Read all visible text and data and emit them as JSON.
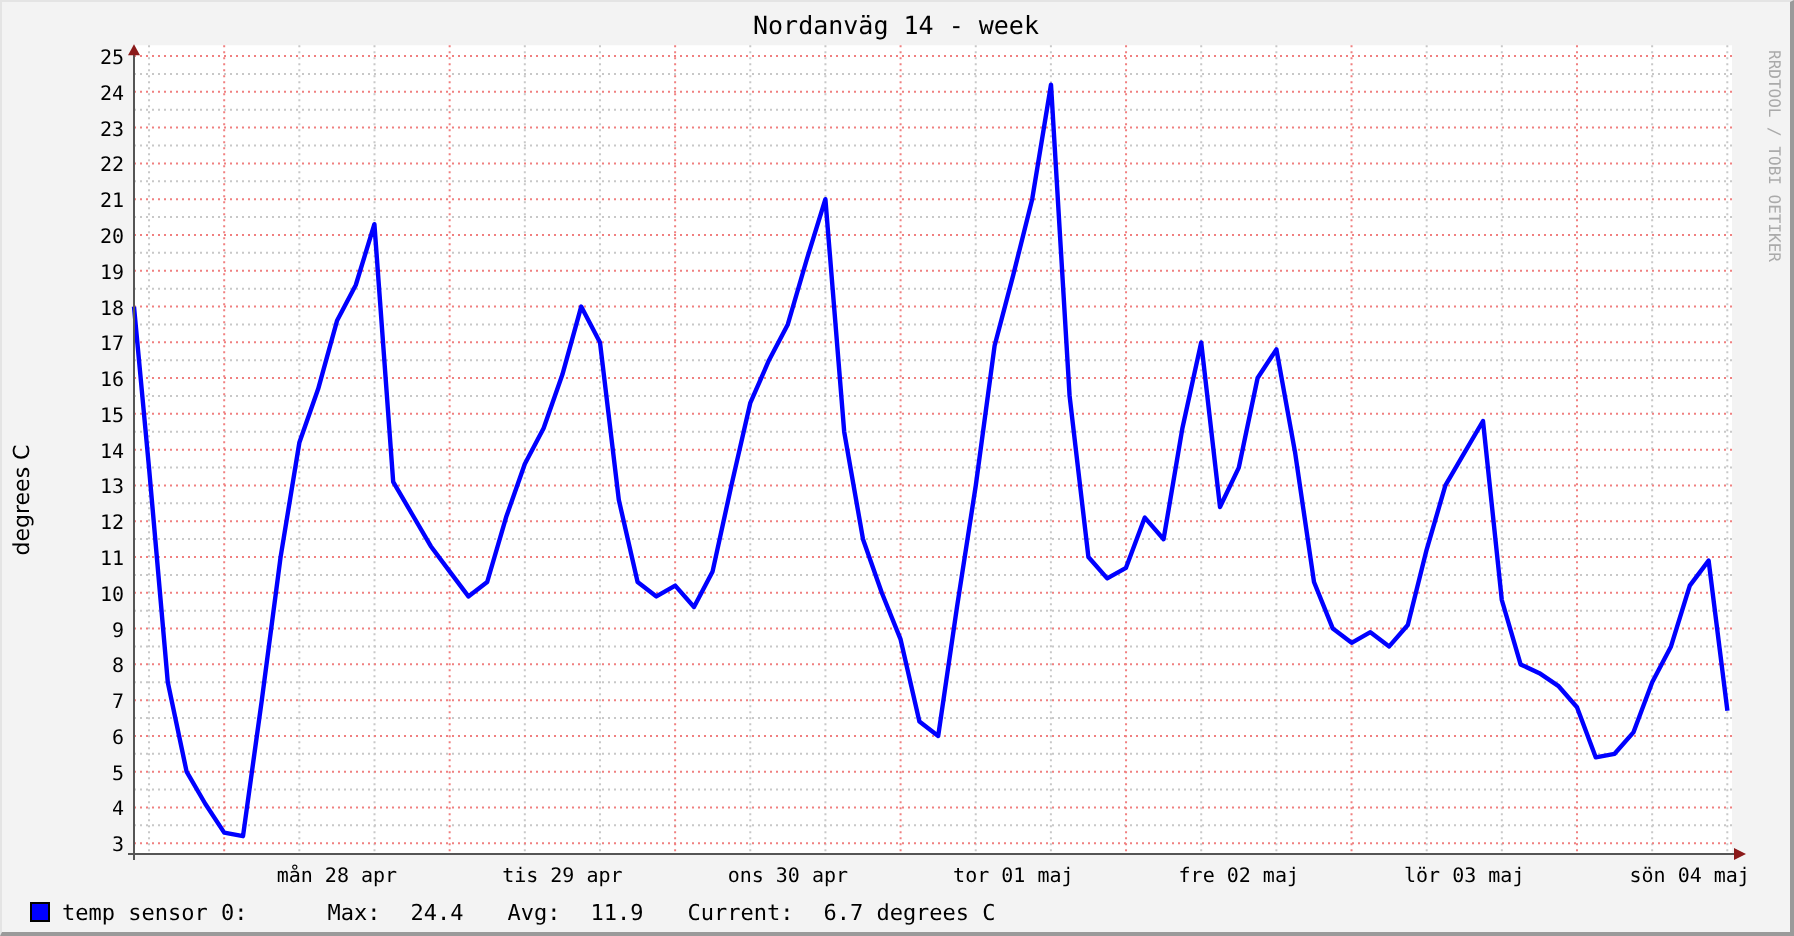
{
  "title": "Nordanväg 14 - week",
  "side_text": "RRDTOOL / TOBI OETIKER",
  "chart": {
    "chart_data": {
      "type": "line",
      "ylabel": "degrees C",
      "grid": true,
      "categories": [
        null,
        null,
        null,
        null,
        null,
        null,
        null,
        null,
        null,
        null,
        null,
        "mån 28 apr",
        null,
        null,
        null,
        null,
        null,
        null,
        null,
        null,
        null,
        null,
        null,
        "tis 29 apr",
        null,
        null,
        null,
        null,
        null,
        null,
        null,
        null,
        null,
        null,
        null,
        "ons 30 apr",
        null,
        null,
        null,
        null,
        null,
        null,
        null,
        null,
        null,
        null,
        null,
        "tor 01 maj",
        null,
        null,
        null,
        null,
        null,
        null,
        null,
        null,
        null,
        null,
        null,
        "fre 02 maj",
        null,
        null,
        null,
        null,
        null,
        null,
        null,
        null,
        null,
        null,
        null,
        "lör 03 maj",
        null,
        null,
        null,
        null,
        null,
        null,
        null,
        null,
        null,
        null,
        null,
        "sön 04 maj",
        null,
        null
      ],
      "series": [
        {
          "name": "temp sensor 0:",
          "color": "#0000ff",
          "values": [
            18,
            13.5,
            7.5,
            5.0,
            4.1,
            3.3,
            3.2,
            7.0,
            11.0,
            14.2,
            15.7,
            17.6,
            18.6,
            20.3,
            13.1,
            12.2,
            11.3,
            10.6,
            9.9,
            10.3,
            12.1,
            13.6,
            14.6,
            16.1,
            18.0,
            17.0,
            12.6,
            10.3,
            9.9,
            10.2,
            9.6,
            10.6,
            13.0,
            15.3,
            16.5,
            17.5,
            19.3,
            21.0,
            14.5,
            11.5,
            10.0,
            8.7,
            6.4,
            6.0,
            9.6,
            13.0,
            16.9,
            18.9,
            21.0,
            24.2,
            15.5,
            11.0,
            10.4,
            10.7,
            12.1,
            11.5,
            14.6,
            17.0,
            12.4,
            13.5,
            16.0,
            16.8,
            13.9,
            10.3,
            9.0,
            8.6,
            8.9,
            8.5,
            9.1,
            11.2,
            13.0,
            13.9,
            14.8,
            9.8,
            8.0,
            7.75,
            7.4,
            6.8,
            5.4,
            5.5,
            6.1,
            7.5,
            8.5,
            10.2,
            10.9,
            6.7
          ]
        }
      ],
      "ylim": [
        2.7,
        25.3
      ],
      "yticks": [
        3,
        4,
        5,
        6,
        7,
        8,
        9,
        10,
        11,
        12,
        13,
        14,
        15,
        16,
        17,
        18,
        19,
        20,
        21,
        22,
        23,
        24,
        25
      ]
    }
  },
  "legend": {
    "max_label": "Max:",
    "max": "24.4",
    "avg_label": "Avg:",
    "avg": "11.9",
    "current_label": "Current:",
    "current": "6.7 degrees C"
  }
}
